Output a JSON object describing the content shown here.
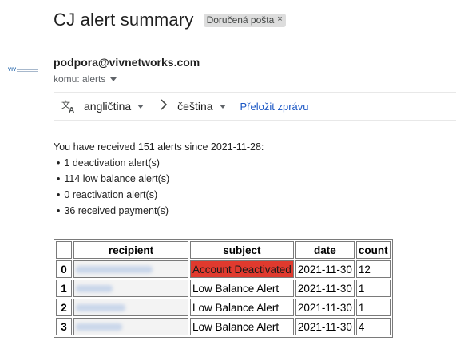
{
  "email": {
    "subject": "CJ alert summary",
    "label_chip": "Doručená pošta",
    "label_close_icon": "×",
    "logo_text": "VIV",
    "sender": "podpora@vivnetworks.com",
    "recipient_line": "komu: alerts"
  },
  "translate": {
    "source_language": "angličtina",
    "target_language": "čeština",
    "translate_link": "Přeložit zprávu"
  },
  "body": {
    "intro": "You have received 151 alerts since 2021-11-28:",
    "bullets": [
      "1 deactivation alert(s)",
      "114 low balance alert(s)",
      "0 reactivation alert(s)",
      "36 received payment(s)"
    ]
  },
  "table": {
    "headers": [
      "",
      "recipient",
      "subject",
      "date",
      "count"
    ],
    "rows": [
      {
        "index": "0",
        "subject": "Account Deactivated",
        "date": "2021-11-30",
        "count": "12",
        "highlight": "#e03a2e"
      },
      {
        "index": "1",
        "subject": "Low Balance Alert",
        "date": "2021-11-30",
        "count": "1"
      },
      {
        "index": "2",
        "subject": "Low Balance Alert",
        "date": "2021-11-30",
        "count": "1"
      },
      {
        "index": "3",
        "subject": "Low Balance Alert",
        "date": "2021-11-30",
        "count": "4"
      }
    ]
  },
  "colors": {
    "link": "#1a56c4",
    "alert_highlight": "#e03a2e",
    "chip_background": "#dddddd"
  },
  "icons": {
    "translate": "translate-icon",
    "dropdown": "chevron-down-icon",
    "arrow": "chevron-right-icon",
    "close": "close-icon"
  }
}
